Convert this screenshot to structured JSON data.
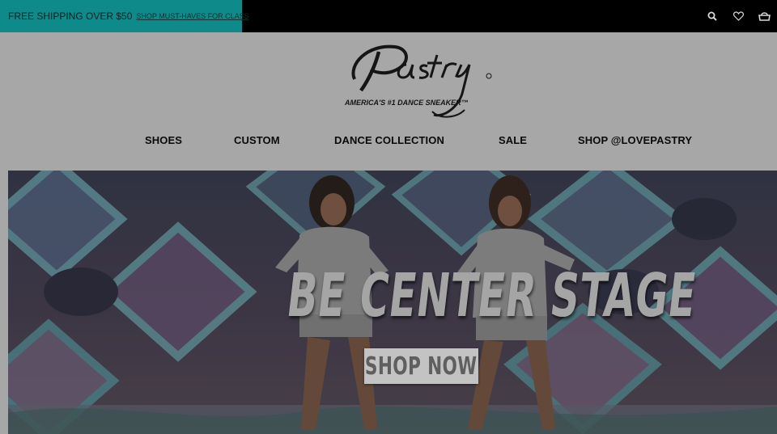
{
  "promo": {
    "text": "FREE SHIPPING OVER $50",
    "link": "SHOP MUST-HAVES FOR CLASS"
  },
  "header_icons": [
    "search-icon",
    "heart-icon",
    "cart-icon"
  ],
  "logo": {
    "wordmark": "Pastry",
    "tagline": "AMERICA'S #1 DANCE SNEAKER™"
  },
  "nav": {
    "items": [
      {
        "label": "SHOES"
      },
      {
        "label": "CUSTOM"
      },
      {
        "label": "DANCE COLLECTION"
      },
      {
        "label": "SALE"
      },
      {
        "label": "SHOP @LOVEPASTRY"
      }
    ]
  },
  "hero": {
    "headline": "BE CENTER STAGE",
    "cta": "SHOP NOW"
  },
  "colors": {
    "topbar": "#000000",
    "promo_bg": "#0e8a8a",
    "page_bg": "#a7a7a7"
  }
}
